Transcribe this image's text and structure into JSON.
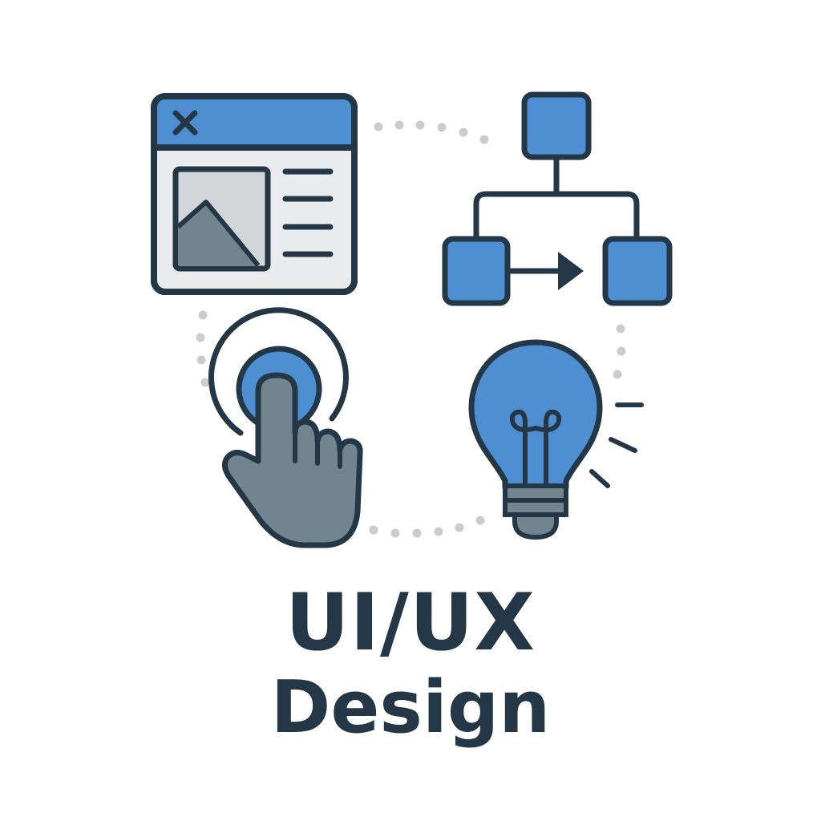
{
  "title": {
    "line1": "UI/UX",
    "line2": "Design"
  },
  "icons": [
    "browser-window-icon",
    "flowchart-icon",
    "tap-gesture-icon",
    "lightbulb-icon"
  ],
  "colors": {
    "accent_blue": "#4D8FD1",
    "outline": "#243746",
    "hand_gray": "#71858F",
    "panel_gray": "#E9EBEC",
    "image_gray": "#D2D6D8",
    "dots": "#C9CDD0",
    "background": "#FFFFFF"
  }
}
